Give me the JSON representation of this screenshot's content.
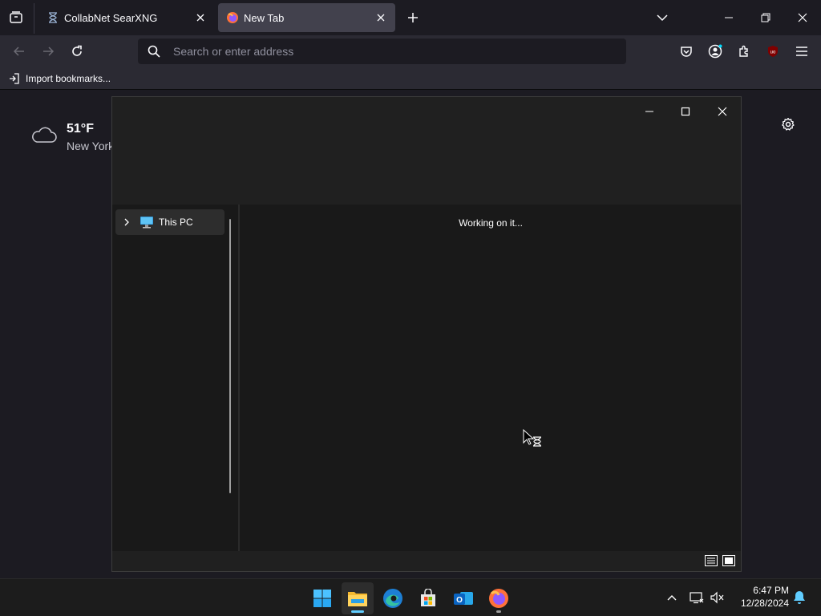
{
  "browser": {
    "tabs": [
      {
        "title": "CollabNet SearXNG",
        "icon": "hourglass-icon",
        "active": false
      },
      {
        "title": "New Tab",
        "icon": "firefox-icon",
        "active": true
      }
    ],
    "url_placeholder": "Search or enter address",
    "bookmarks": [
      {
        "label": "Import bookmarks...",
        "icon": "import-icon"
      }
    ]
  },
  "new_tab_page": {
    "weather": {
      "temperature": "51°F",
      "location": "New York",
      "icon": "cloud-icon"
    }
  },
  "explorer_dialog": {
    "nav_tree": [
      {
        "label": "This PC",
        "icon": "computer-icon",
        "expanded": false,
        "selected": true
      }
    ],
    "status_message": "Working on it..."
  },
  "taskbar": {
    "apps": [
      {
        "name": "start",
        "icon": "windows-logo-icon"
      },
      {
        "name": "file-explorer",
        "icon": "folder-icon",
        "active": true
      },
      {
        "name": "edge",
        "icon": "edge-icon"
      },
      {
        "name": "store",
        "icon": "store-icon"
      },
      {
        "name": "outlook",
        "icon": "outlook-icon"
      },
      {
        "name": "firefox",
        "icon": "firefox-icon",
        "running": true
      }
    ],
    "clock": {
      "time": "6:47 PM",
      "date": "12/28/2024"
    }
  },
  "colors": {
    "accent": "#60cdff",
    "browser_bg": "#1c1b22",
    "toolbar_bg": "#2b2a33",
    "dialog_bg": "#202020"
  }
}
